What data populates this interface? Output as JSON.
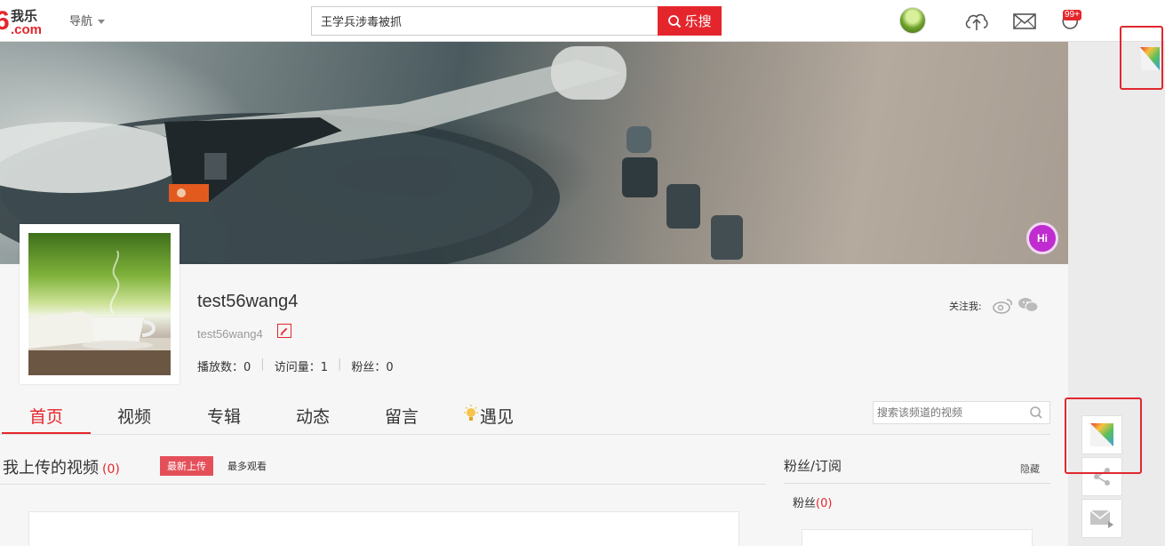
{
  "header": {
    "logo_number": "6",
    "logo_text": "我乐",
    "logo_domain": ".com",
    "nav_label": "导航",
    "search_value": "王学兵涉毒被抓",
    "search_button": "乐搜",
    "notification_badge": "99+"
  },
  "banner": {
    "hi_badge": "Hi"
  },
  "profile": {
    "username": "test56wang4",
    "user_id": "test56wang4",
    "stats": [
      {
        "label": "播放数：",
        "value": "0"
      },
      {
        "label": "访问量：",
        "value": "1"
      },
      {
        "label": "粉丝：",
        "value": "0"
      }
    ],
    "follow_label": "关注我:"
  },
  "tabs": [
    {
      "label": "首页",
      "active": true
    },
    {
      "label": "视频",
      "active": false
    },
    {
      "label": "专辑",
      "active": false
    },
    {
      "label": "动态",
      "active": false
    },
    {
      "label": "留言",
      "active": false
    },
    {
      "label": "遇见",
      "active": false
    }
  ],
  "channel_search": {
    "placeholder": "搜索该频道的视频"
  },
  "videos": {
    "title": "我上传的视频",
    "count": "(0)",
    "latest_button": "最新上传",
    "most_viewed": "最多观看"
  },
  "fans": {
    "title": "粉丝/订阅",
    "hide_label": "隐藏",
    "fans_label": "粉丝",
    "fans_count": "(0)"
  },
  "colors": {
    "accent": "#e4262c",
    "highlight_box": "#e0282e",
    "hi_badge": "#c02ccf"
  },
  "icons": [
    "upload-icon",
    "mail-icon",
    "refresh-message-icon",
    "weibo-icon",
    "wechat-icon",
    "edit-icon",
    "lightbulb-icon",
    "search-icon",
    "skin-icon",
    "share-icon",
    "feedback-icon"
  ]
}
